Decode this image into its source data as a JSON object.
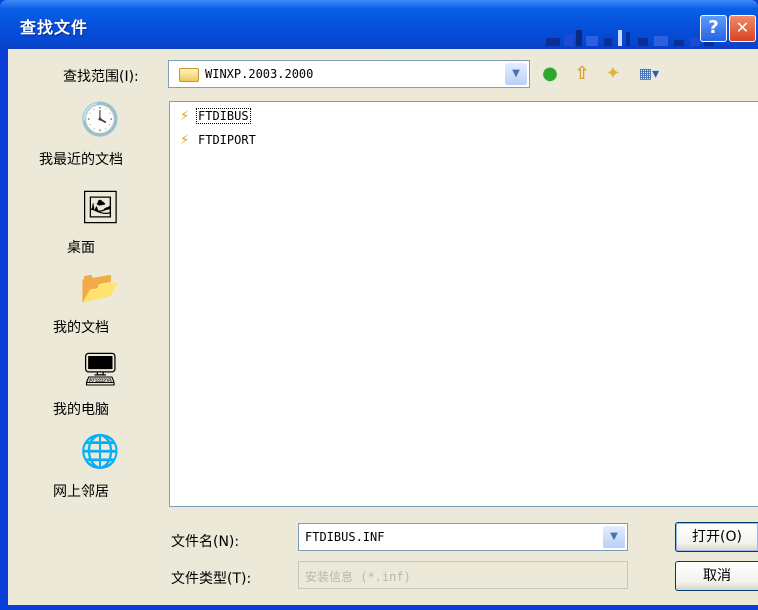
{
  "window": {
    "title": "查找文件",
    "help_label": "?",
    "close_label": "✕"
  },
  "toolbar": {
    "lookin_label": "查找范围(I):",
    "lookin_value": "WINXP.2003.2000",
    "back_icon": "●",
    "up_icon": "⇧",
    "newfolder_icon": "✦",
    "views_icon": "▦▾"
  },
  "places": [
    {
      "label": "我最近的文档",
      "icon": "recent-documents-icon",
      "glyph": "🕓"
    },
    {
      "label": "桌面",
      "icon": "desktop-icon",
      "glyph": "🖼"
    },
    {
      "label": "我的文档",
      "icon": "my-documents-icon",
      "glyph": "📂"
    },
    {
      "label": "我的电脑",
      "icon": "my-computer-icon",
      "glyph": "🖥"
    },
    {
      "label": "网上邻居",
      "icon": "network-places-icon",
      "glyph": "🌐"
    }
  ],
  "files": [
    {
      "name": "FTDIBUS",
      "icon": "setup-info-file-icon"
    },
    {
      "name": "FTDIPORT",
      "icon": "setup-info-file-icon"
    }
  ],
  "form": {
    "filename_label": "文件名(N):",
    "filename_value": "FTDIBUS.INF",
    "filetype_label": "文件类型(T):",
    "filetype_value": "安装信息 (*.inf)",
    "open_label": "打开(O)",
    "cancel_label": "取消"
  },
  "colors": {
    "titlebar": "#0550dd",
    "dialog_background": "#ece9d8",
    "border": "#7f9db9"
  }
}
